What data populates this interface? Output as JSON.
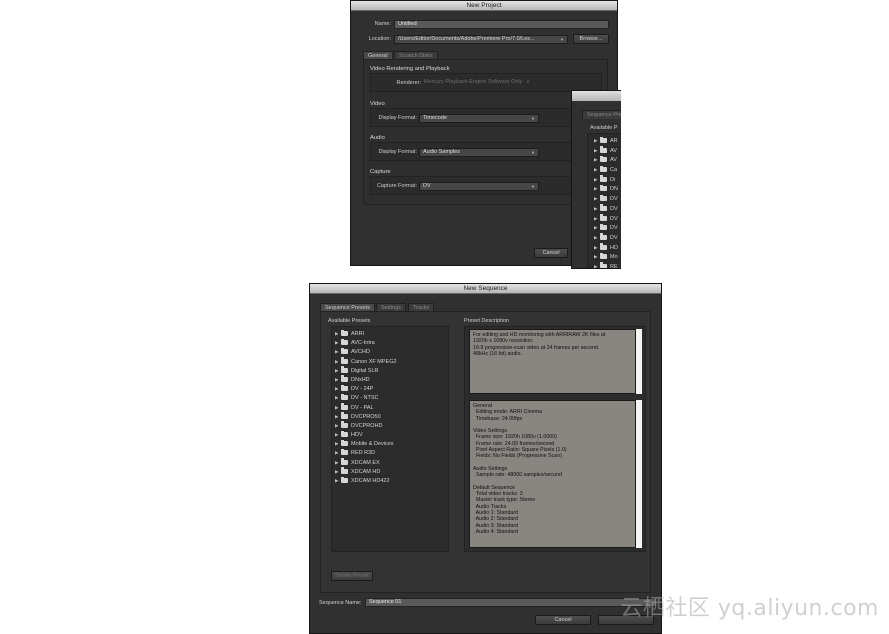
{
  "new_project": {
    "title": "New Project",
    "name_label": "Name:",
    "name_value": "Untitled",
    "location_label": "Location:",
    "location_value": "/Users/Editor/Documents/Adobe/Premiere Pro/7.0/Les...",
    "browse_label": "Browse...",
    "tabs": [
      "General",
      "Scratch Disks"
    ],
    "video_rendering_title": "Video Rendering and Playback",
    "renderer_label": "Renderer:",
    "renderer_value": "Mercury Playback Engine Software Only",
    "video_title": "Video",
    "video_display_label": "Display Format:",
    "video_display_value": "Timecode",
    "audio_title": "Audio",
    "audio_display_label": "Display Format:",
    "audio_display_value": "Audio Samples",
    "capture_title": "Capture",
    "capture_format_label": "Capture Format:",
    "capture_format_value": "DV",
    "cancel_label": "Cancel"
  },
  "behind_sequence": {
    "tab_label": "Sequence Prese",
    "available_label": "Available P",
    "items": [
      "AR",
      "AV",
      "AV",
      "Ca",
      "Di",
      "DN",
      "DV",
      "DV",
      "DV",
      "DV",
      "DV",
      "HD",
      "Mo",
      "RE"
    ]
  },
  "new_sequence": {
    "title": "New Sequence",
    "tabs": [
      "Sequence Presets",
      "Settings",
      "Tracks"
    ],
    "available_presets_label": "Available Presets",
    "presets": [
      "ARRI",
      "AVC-Intra",
      "AVCHD",
      "Canon XF MPEG2",
      "Digital SLR",
      "DNxHD",
      "DV - 24P",
      "DV - NTSC",
      "DV - PAL",
      "DVCPRO50",
      "DVCPROHD",
      "HDV",
      "Mobile & Devices",
      "RED R3D",
      "XDCAM EX",
      "XDCAM HD",
      "XDCAM HD422"
    ],
    "preset_description_label": "Preset Description",
    "description_text": "For editing and HD monitoring with ARRIRAW 2K files at\n1920h x 1080v resolution.\n16:9 progressive-scan video at 24 frames per second.\n48kHz (16 bit) audio.",
    "details_text": "General\n  Editing mode: ARRI Cinema\n  Timebase: 24.00fps\n\nVideo Settings\n  Frame size: 1920h 1080v (1.0000)\n  Frame rate: 24.00 frames/second\n  Pixel Aspect Ratio: Square Pixels (1.0)\n  Fields: No Fields (Progressive Scan)\n\nAudio Settings\n  Sample rate: 48000 samples/second\n\nDefault Sequence\n  Total video tracks: 3\n  Master track type: Stereo\n  Audio Tracks\n  Audio 1: Standard\n  Audio 2: Standard\n  Audio 3: Standard\n  Audio 4: Standard",
    "delete_preset_label": "Delete Preset",
    "sequence_name_label": "Sequence Name:",
    "sequence_name_value": "Sequence 01",
    "cancel_label": "Cancel"
  },
  "watermark": "云栖社区 yq.aliyun.com"
}
